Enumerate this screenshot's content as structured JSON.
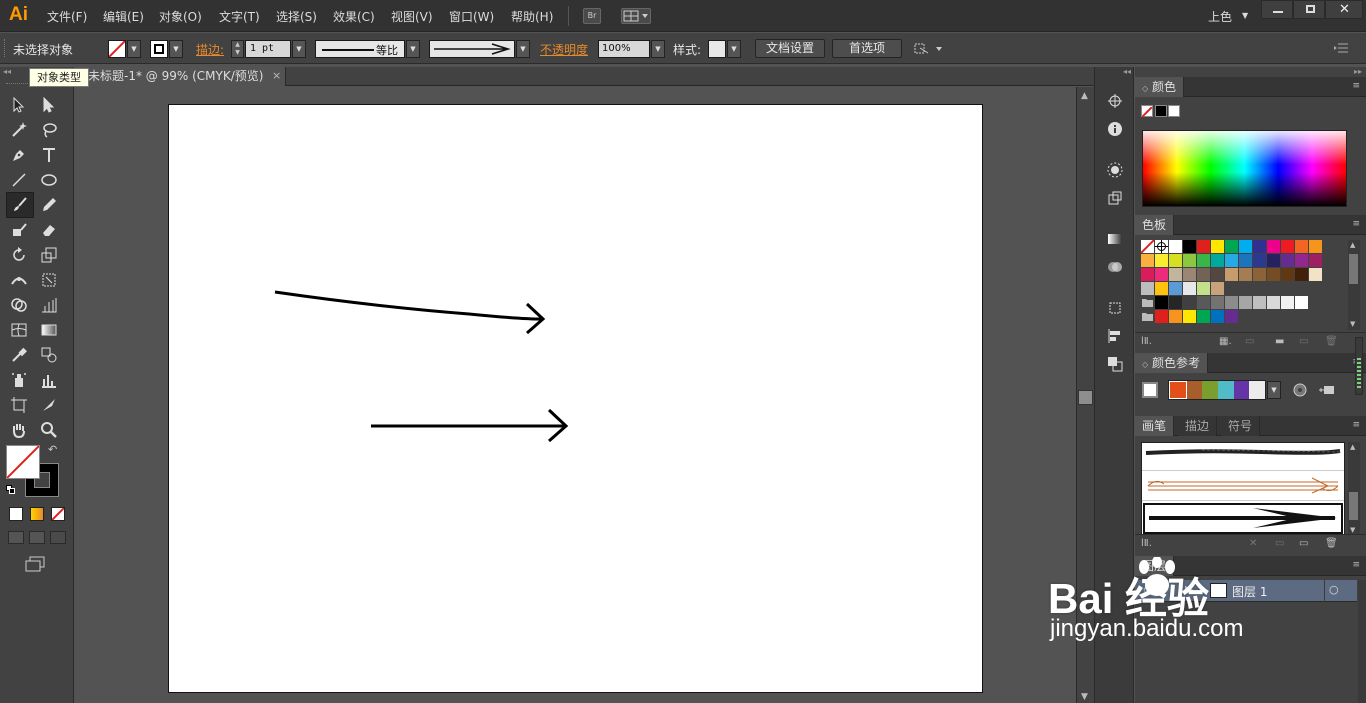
{
  "app": {
    "logo": "Ai",
    "workspace": "上色"
  },
  "menu": [
    "文件(F)",
    "编辑(E)",
    "对象(O)",
    "文字(T)",
    "选择(S)",
    "效果(C)",
    "视图(V)",
    "窗口(W)",
    "帮助(H)"
  ],
  "bridge_label": "Br",
  "control": {
    "selection_status": "未选择对象",
    "stroke_label": "描边:",
    "stroke_weight": "1 pt",
    "profile_label": "等比",
    "opacity_label": "不透明度",
    "opacity_value": "100%",
    "style_label": "样式:",
    "doc_setup_button": "文档设置",
    "preferences_button": "首选项"
  },
  "tooltip": "对象类型",
  "document_tab": {
    "title": "未标题-1* @ 99% (CMYK/预览)",
    "close": "×"
  },
  "panels": {
    "color": {
      "title": "颜色"
    },
    "swatches": {
      "title": "色板"
    },
    "color_guide": {
      "title": "颜色参考"
    },
    "brushes": {
      "tabs": [
        "画笔",
        "描边",
        "符号"
      ]
    },
    "layers": {
      "title": "图层",
      "layer_name": "图层 1"
    }
  },
  "watermark": {
    "brand": "Bai  经验",
    "url": "jingyan.baidu.com"
  },
  "colors": {
    "accent": "#ff9a00",
    "orange_label": "#e88a2a",
    "ui_dark": "#323232",
    "ui_mid": "#424242",
    "canvas_bg": "#535353"
  }
}
